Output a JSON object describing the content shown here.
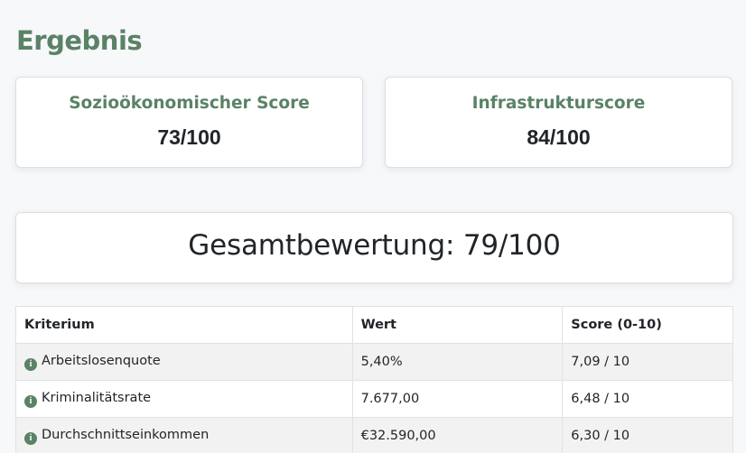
{
  "page": {
    "title": "Ergebnis"
  },
  "scores": {
    "socio": {
      "label": "Sozioökonomischer Score",
      "value": "73/100"
    },
    "infra": {
      "label": "Infrastrukturscore",
      "value": "84/100"
    }
  },
  "total": {
    "text": "Gesamtbewertung: 79/100"
  },
  "table": {
    "headers": [
      "Kriterium",
      "Wert",
      "Score (0-10)"
    ],
    "rows": [
      {
        "criterion": "Arbeitslosenquote",
        "value": "5,40%",
        "score": "7,09 / 10"
      },
      {
        "criterion": "Kriminalitätsrate",
        "value": "7.677,00",
        "score": "6,48 / 10"
      },
      {
        "criterion": "Durchschnittseinkommen",
        "value": "€32.590,00",
        "score": "6,30 / 10"
      }
    ],
    "info_icon": {
      "glyph": "i",
      "icon": "info-circle-icon",
      "color": "#5a8266"
    }
  },
  "colors": {
    "accent": "#5a8266",
    "text": "#212529"
  }
}
